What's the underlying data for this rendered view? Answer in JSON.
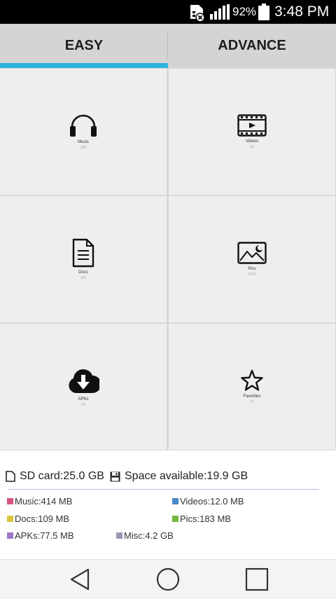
{
  "status_bar": {
    "battery_percent": "92%",
    "time": "3:48 PM"
  },
  "tabs": [
    {
      "label": "EASY",
      "selected": true
    },
    {
      "label": "ADVANCE",
      "selected": false
    }
  ],
  "accent_color": "#2fb3e0",
  "categories": [
    {
      "label": "Music",
      "count": "363",
      "icon": "headphones-icon"
    },
    {
      "label": "Videos",
      "count": "18",
      "icon": "film-icon"
    },
    {
      "label": "Docs",
      "count": "263",
      "icon": "document-icon"
    },
    {
      "label": "Pics",
      "count": "2872",
      "icon": "image-icon"
    },
    {
      "label": "APKs",
      "count": "16",
      "icon": "cloud-download-icon"
    },
    {
      "label": "Favorites",
      "count": "10",
      "icon": "star-icon"
    }
  ],
  "storage": {
    "sd_card": "SD card:25.0 GB",
    "space_available": "Space available:19.9 GB"
  },
  "legend": [
    {
      "label": "Music:414 MB",
      "color": "#d9547c"
    },
    {
      "label": "Videos:12.0 MB",
      "color": "#4a86c8"
    },
    {
      "label": "Docs:109 MB",
      "color": "#d9c43a"
    },
    {
      "label": "Pics:183 MB",
      "color": "#74b83d"
    },
    {
      "label": "APKs:77.5 MB",
      "color": "#a078c8"
    },
    {
      "label": "Misc:4.2 GB",
      "color": "#9a96b8"
    }
  ]
}
